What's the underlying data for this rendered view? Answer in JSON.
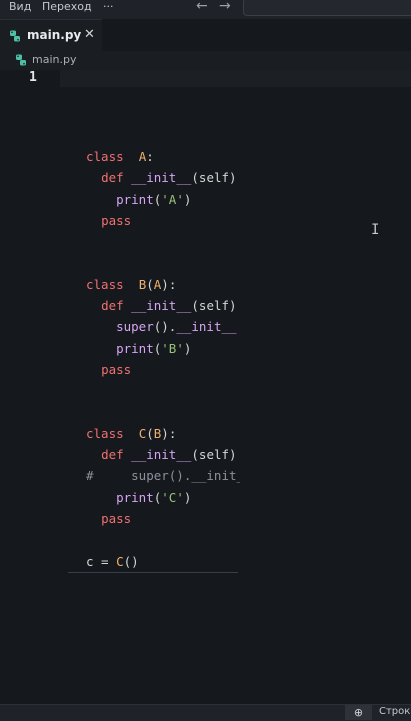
{
  "menu": {
    "view": "Вид",
    "go": "Переход",
    "more": "···",
    "back": "←",
    "forward": "→"
  },
  "tab": {
    "filename": "main.py",
    "close": "✕"
  },
  "breadcrumb": {
    "filename": "main.py"
  },
  "editor": {
    "current_line": "1",
    "cursor_glyph": "I",
    "lines": [
      [
        [
          "kw",
          "class"
        ],
        [
          "",
          "  "
        ],
        [
          "cls",
          "A"
        ],
        [
          "",
          ":"
        ]
      ],
      [
        [
          "",
          "  "
        ],
        [
          "kw",
          "def"
        ],
        [
          "",
          " "
        ],
        [
          "fn",
          "__init__"
        ],
        [
          "",
          "(self)"
        ]
      ],
      [
        [
          "",
          "    "
        ],
        [
          "fn",
          "print"
        ],
        [
          "",
          "("
        ],
        [
          "str",
          "'A'"
        ],
        [
          "",
          ")"
        ]
      ],
      [
        [
          "",
          "  "
        ],
        [
          "kw",
          "pass"
        ]
      ],
      [],
      [],
      [
        [
          "kw",
          "class"
        ],
        [
          "",
          "  "
        ],
        [
          "cls",
          "B"
        ],
        [
          "",
          "("
        ],
        [
          "cls",
          "A"
        ],
        [
          "",
          "):"
        ]
      ],
      [
        [
          "",
          "  "
        ],
        [
          "kw",
          "def"
        ],
        [
          "",
          " "
        ],
        [
          "fn",
          "__init__"
        ],
        [
          "",
          "(self)"
        ]
      ],
      [
        [
          "",
          "    "
        ],
        [
          "fn",
          "super"
        ],
        [
          "",
          "()."
        ],
        [
          "fn",
          "__init__"
        ]
      ],
      [
        [
          "",
          "    "
        ],
        [
          "fn",
          "print"
        ],
        [
          "",
          "("
        ],
        [
          "str",
          "'B'"
        ],
        [
          "",
          ")"
        ]
      ],
      [
        [
          "",
          "  "
        ],
        [
          "kw",
          "pass"
        ]
      ],
      [],
      [],
      [
        [
          "kw",
          "class"
        ],
        [
          "",
          "  "
        ],
        [
          "cls",
          "C"
        ],
        [
          "",
          "("
        ],
        [
          "cls",
          "B"
        ],
        [
          "",
          "):"
        ]
      ],
      [
        [
          "",
          "  "
        ],
        [
          "kw",
          "def"
        ],
        [
          "",
          " "
        ],
        [
          "fn",
          "__init__"
        ],
        [
          "",
          "(self)"
        ]
      ],
      [
        [
          "cm",
          "#     super().__init__"
        ]
      ],
      [
        [
          "",
          "    "
        ],
        [
          "fn",
          "print"
        ],
        [
          "",
          "("
        ],
        [
          "str",
          "'C'"
        ],
        [
          "",
          ")"
        ]
      ],
      [
        [
          "",
          "  "
        ],
        [
          "kw",
          "pass"
        ]
      ],
      [],
      [
        [
          "",
          "c = "
        ],
        [
          "cls",
          "C"
        ],
        [
          "",
          "()"
        ]
      ]
    ]
  },
  "status": {
    "zoom_icon": "⊕",
    "position": "Строка"
  },
  "colors": {
    "keyword": "#f07171",
    "class": "#f0b16a",
    "function": "#d6a6f5",
    "string": "#98c379",
    "python_icon": "#4fc1a6"
  }
}
